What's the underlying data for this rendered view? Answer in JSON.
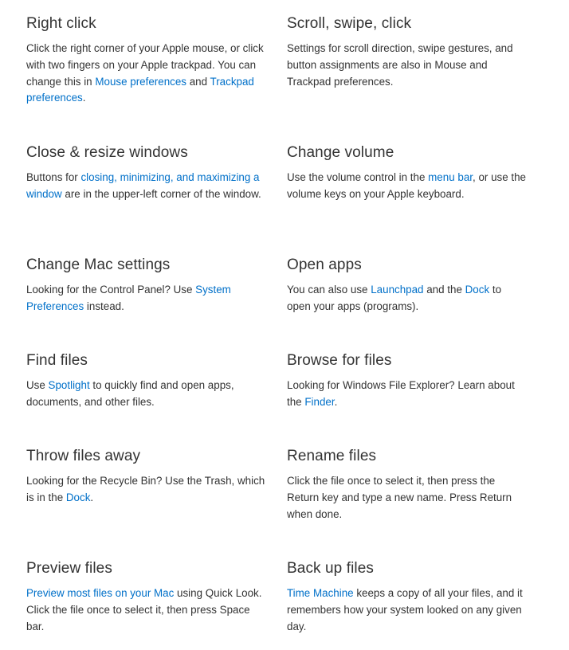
{
  "tips": [
    {
      "id": "right-click",
      "title": "Right click",
      "segments": [
        {
          "text": "Click the right corner of your Apple mouse, or click with two fingers on your Apple trackpad. You can change this in "
        },
        {
          "text": "Mouse preferences",
          "link": true
        },
        {
          "text": " and "
        },
        {
          "text": "Trackpad preferences",
          "link": true
        },
        {
          "text": "."
        }
      ]
    },
    {
      "id": "scroll-swipe-click",
      "title": "Scroll, swipe, click",
      "segments": [
        {
          "text": "Settings for scroll direction, swipe gestures, and button assignments are also in Mouse and Trackpad preferences."
        }
      ]
    },
    {
      "id": "close-resize-windows",
      "title": "Close & resize windows",
      "segments": [
        {
          "text": "Buttons for "
        },
        {
          "text": "closing, minimizing, and maximizing a window",
          "link": true
        },
        {
          "text": " are in the upper-left corner of the window."
        }
      ]
    },
    {
      "id": "change-volume",
      "title": "Change volume",
      "segments": [
        {
          "text": "Use the volume control in the "
        },
        {
          "text": "menu bar",
          "link": true
        },
        {
          "text": ", or use the volume keys on your Apple keyboard."
        }
      ]
    },
    {
      "id": "change-mac-settings",
      "title": "Change Mac settings",
      "segments": [
        {
          "text": "Looking for the Control Panel? Use "
        },
        {
          "text": "System Preferences",
          "link": true
        },
        {
          "text": " instead."
        }
      ]
    },
    {
      "id": "open-apps",
      "title": "Open apps",
      "segments": [
        {
          "text": "You can also use "
        },
        {
          "text": "Launchpad",
          "link": true
        },
        {
          "text": " and the "
        },
        {
          "text": "Dock",
          "link": true
        },
        {
          "text": " to open your apps (programs)."
        }
      ]
    },
    {
      "id": "find-files",
      "title": "Find files",
      "segments": [
        {
          "text": "Use "
        },
        {
          "text": "Spotlight",
          "link": true
        },
        {
          "text": " to quickly find and open apps, documents, and other files."
        }
      ]
    },
    {
      "id": "browse-for-files",
      "title": "Browse for files",
      "segments": [
        {
          "text": "Looking for Windows File Explorer? Learn about the "
        },
        {
          "text": "Finder",
          "link": true
        },
        {
          "text": "."
        }
      ]
    },
    {
      "id": "throw-files-away",
      "title": "Throw files away",
      "segments": [
        {
          "text": "Looking for the Recycle Bin? Use the Trash, which is in the "
        },
        {
          "text": "Dock",
          "link": true
        },
        {
          "text": "."
        }
      ]
    },
    {
      "id": "rename-files",
      "title": "Rename files",
      "segments": [
        {
          "text": "Click the file once to select it, then press the Return key and type a new name. Press Return when done."
        }
      ]
    },
    {
      "id": "preview-files",
      "title": "Preview files",
      "segments": [
        {
          "text": "Preview most files on your Mac",
          "link": true
        },
        {
          "text": " using Quick Look. Click the file once to select it, then press Space bar."
        }
      ]
    },
    {
      "id": "back-up-files",
      "title": "Back up files",
      "segments": [
        {
          "text": "Time Machine",
          "link": true
        },
        {
          "text": " keeps a copy of all your files, and it remembers how your system looked on any given day."
        }
      ]
    }
  ],
  "colors": {
    "text": "#333333",
    "link": "#0070c9",
    "background": "#ffffff"
  }
}
